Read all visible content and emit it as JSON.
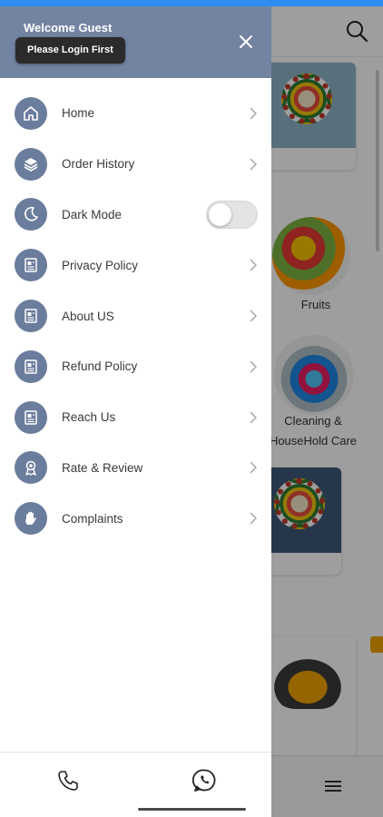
{
  "colors": {
    "status_strip": "#2f8cf0",
    "drawer_header": "#7384a2",
    "icon_circle": "#6b7d9c",
    "login_chip": "#2b2b2b",
    "toggle_off": "#e4e4e4"
  },
  "drawer": {
    "welcome_text": "Welcome Guest",
    "login_prompt": "Please Login First",
    "close_icon": "close-icon",
    "items": [
      {
        "label": "Home",
        "icon": "home-icon",
        "control": "chevron"
      },
      {
        "label": "Order History",
        "icon": "layers-icon",
        "control": "chevron"
      },
      {
        "label": "Dark Mode",
        "icon": "moon-icon",
        "control": "toggle",
        "toggle_on": false
      },
      {
        "label": "Privacy Policy",
        "icon": "document-icon",
        "control": "chevron"
      },
      {
        "label": "About US",
        "icon": "document-icon",
        "control": "chevron"
      },
      {
        "label": "Refund Policy",
        "icon": "document-icon",
        "control": "chevron"
      },
      {
        "label": "Reach Us",
        "icon": "document-icon",
        "control": "chevron"
      },
      {
        "label": "Rate & Review",
        "icon": "award-icon",
        "control": "chevron"
      },
      {
        "label": "Complaints",
        "icon": "hand-icon",
        "control": "chevron"
      }
    ],
    "footer": {
      "phone_icon": "phone-icon",
      "whatsapp_icon": "whatsapp-icon"
    }
  },
  "background": {
    "categories": [
      {
        "label": "Fruits"
      },
      {
        "label": "Cleaning &"
      },
      {
        "label": "HouseHold Care"
      }
    ],
    "search_icon": "search-icon",
    "menu_icon": "hamburger-menu-icon"
  }
}
